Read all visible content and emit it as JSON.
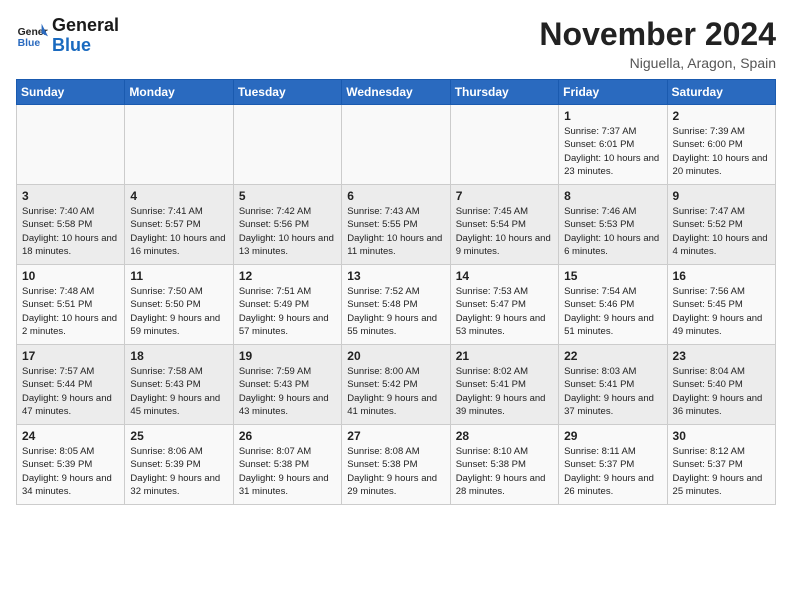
{
  "logo": {
    "line1": "General",
    "line2": "Blue"
  },
  "title": "November 2024",
  "location": "Niguella, Aragon, Spain",
  "weekdays": [
    "Sunday",
    "Monday",
    "Tuesday",
    "Wednesday",
    "Thursday",
    "Friday",
    "Saturday"
  ],
  "weeks": [
    [
      {
        "day": "",
        "info": ""
      },
      {
        "day": "",
        "info": ""
      },
      {
        "day": "",
        "info": ""
      },
      {
        "day": "",
        "info": ""
      },
      {
        "day": "",
        "info": ""
      },
      {
        "day": "1",
        "info": "Sunrise: 7:37 AM\nSunset: 6:01 PM\nDaylight: 10 hours and 23 minutes."
      },
      {
        "day": "2",
        "info": "Sunrise: 7:39 AM\nSunset: 6:00 PM\nDaylight: 10 hours and 20 minutes."
      }
    ],
    [
      {
        "day": "3",
        "info": "Sunrise: 7:40 AM\nSunset: 5:58 PM\nDaylight: 10 hours and 18 minutes."
      },
      {
        "day": "4",
        "info": "Sunrise: 7:41 AM\nSunset: 5:57 PM\nDaylight: 10 hours and 16 minutes."
      },
      {
        "day": "5",
        "info": "Sunrise: 7:42 AM\nSunset: 5:56 PM\nDaylight: 10 hours and 13 minutes."
      },
      {
        "day": "6",
        "info": "Sunrise: 7:43 AM\nSunset: 5:55 PM\nDaylight: 10 hours and 11 minutes."
      },
      {
        "day": "7",
        "info": "Sunrise: 7:45 AM\nSunset: 5:54 PM\nDaylight: 10 hours and 9 minutes."
      },
      {
        "day": "8",
        "info": "Sunrise: 7:46 AM\nSunset: 5:53 PM\nDaylight: 10 hours and 6 minutes."
      },
      {
        "day": "9",
        "info": "Sunrise: 7:47 AM\nSunset: 5:52 PM\nDaylight: 10 hours and 4 minutes."
      }
    ],
    [
      {
        "day": "10",
        "info": "Sunrise: 7:48 AM\nSunset: 5:51 PM\nDaylight: 10 hours and 2 minutes."
      },
      {
        "day": "11",
        "info": "Sunrise: 7:50 AM\nSunset: 5:50 PM\nDaylight: 9 hours and 59 minutes."
      },
      {
        "day": "12",
        "info": "Sunrise: 7:51 AM\nSunset: 5:49 PM\nDaylight: 9 hours and 57 minutes."
      },
      {
        "day": "13",
        "info": "Sunrise: 7:52 AM\nSunset: 5:48 PM\nDaylight: 9 hours and 55 minutes."
      },
      {
        "day": "14",
        "info": "Sunrise: 7:53 AM\nSunset: 5:47 PM\nDaylight: 9 hours and 53 minutes."
      },
      {
        "day": "15",
        "info": "Sunrise: 7:54 AM\nSunset: 5:46 PM\nDaylight: 9 hours and 51 minutes."
      },
      {
        "day": "16",
        "info": "Sunrise: 7:56 AM\nSunset: 5:45 PM\nDaylight: 9 hours and 49 minutes."
      }
    ],
    [
      {
        "day": "17",
        "info": "Sunrise: 7:57 AM\nSunset: 5:44 PM\nDaylight: 9 hours and 47 minutes."
      },
      {
        "day": "18",
        "info": "Sunrise: 7:58 AM\nSunset: 5:43 PM\nDaylight: 9 hours and 45 minutes."
      },
      {
        "day": "19",
        "info": "Sunrise: 7:59 AM\nSunset: 5:43 PM\nDaylight: 9 hours and 43 minutes."
      },
      {
        "day": "20",
        "info": "Sunrise: 8:00 AM\nSunset: 5:42 PM\nDaylight: 9 hours and 41 minutes."
      },
      {
        "day": "21",
        "info": "Sunrise: 8:02 AM\nSunset: 5:41 PM\nDaylight: 9 hours and 39 minutes."
      },
      {
        "day": "22",
        "info": "Sunrise: 8:03 AM\nSunset: 5:41 PM\nDaylight: 9 hours and 37 minutes."
      },
      {
        "day": "23",
        "info": "Sunrise: 8:04 AM\nSunset: 5:40 PM\nDaylight: 9 hours and 36 minutes."
      }
    ],
    [
      {
        "day": "24",
        "info": "Sunrise: 8:05 AM\nSunset: 5:39 PM\nDaylight: 9 hours and 34 minutes."
      },
      {
        "day": "25",
        "info": "Sunrise: 8:06 AM\nSunset: 5:39 PM\nDaylight: 9 hours and 32 minutes."
      },
      {
        "day": "26",
        "info": "Sunrise: 8:07 AM\nSunset: 5:38 PM\nDaylight: 9 hours and 31 minutes."
      },
      {
        "day": "27",
        "info": "Sunrise: 8:08 AM\nSunset: 5:38 PM\nDaylight: 9 hours and 29 minutes."
      },
      {
        "day": "28",
        "info": "Sunrise: 8:10 AM\nSunset: 5:38 PM\nDaylight: 9 hours and 28 minutes."
      },
      {
        "day": "29",
        "info": "Sunrise: 8:11 AM\nSunset: 5:37 PM\nDaylight: 9 hours and 26 minutes."
      },
      {
        "day": "30",
        "info": "Sunrise: 8:12 AM\nSunset: 5:37 PM\nDaylight: 9 hours and 25 minutes."
      }
    ]
  ]
}
